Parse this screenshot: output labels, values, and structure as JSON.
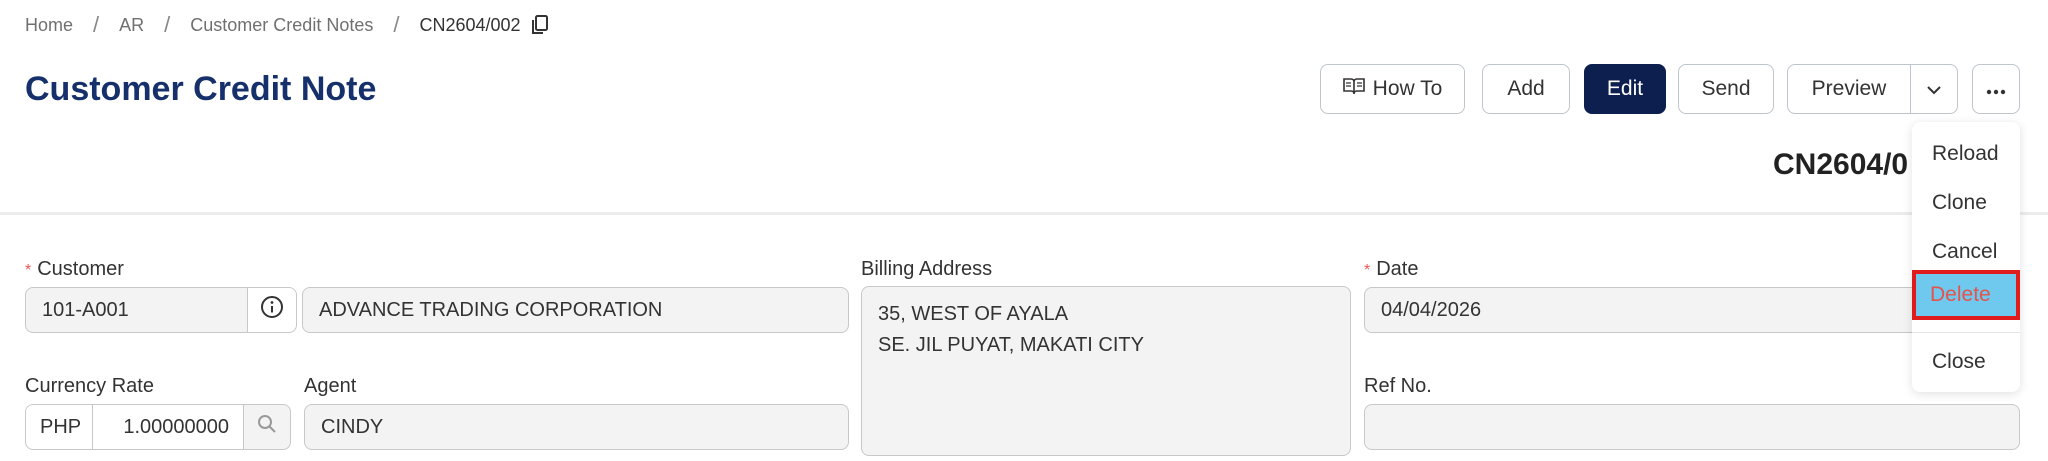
{
  "breadcrumb": {
    "items": [
      "Home",
      "AR",
      "Customer Credit Notes",
      "CN2604/002"
    ]
  },
  "header": {
    "title": "Customer Credit Note",
    "buttons": {
      "how_to": "How To",
      "add": "Add",
      "edit": "Edit",
      "send": "Send",
      "preview": "Preview"
    }
  },
  "document": {
    "number": "CN2604/0"
  },
  "menu": {
    "items": [
      "Reload",
      "Clone",
      "Cancel",
      "Delete",
      "Close"
    ]
  },
  "form": {
    "customer": {
      "label": "Customer",
      "code": "101-A001",
      "name": "ADVANCE TRADING CORPORATION"
    },
    "billing": {
      "label": "Billing Address",
      "line1": "35, WEST OF AYALA",
      "line2": "SE. JIL PUYAT, MAKATI CITY"
    },
    "date": {
      "label": "Date",
      "value": "04/04/2026"
    },
    "currency": {
      "label": "Currency Rate",
      "code": "PHP",
      "rate": "1.00000000"
    },
    "agent": {
      "label": "Agent",
      "value": "CINDY"
    },
    "ref": {
      "label": "Ref No.",
      "value": ""
    }
  },
  "colors": {
    "title": "#15306b",
    "primary_button": "#0d1f4f",
    "highlight": "#6fc8ee",
    "highlight_border": "#e01b1b",
    "required": "#e55"
  }
}
